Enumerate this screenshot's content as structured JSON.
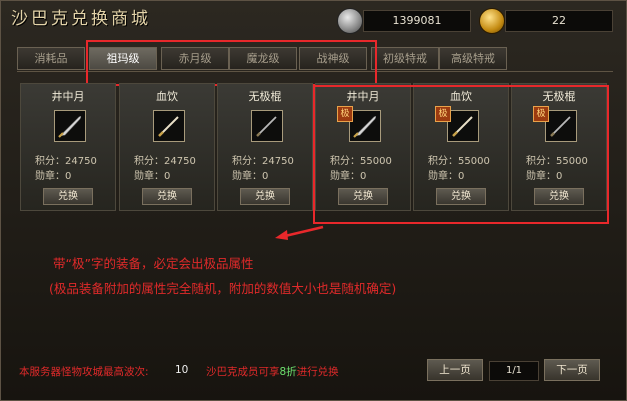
{
  "window": {
    "title": "沙巴克兑换商城"
  },
  "currency": {
    "silver": "1399081",
    "gold": "22"
  },
  "tabs": [
    {
      "label": "消耗品"
    },
    {
      "label": "祖玛级"
    },
    {
      "label": "赤月级"
    },
    {
      "label": "魔龙级"
    },
    {
      "label": "战神级"
    },
    {
      "label": "初级特戒"
    },
    {
      "label": "高级特戒"
    }
  ],
  "items": [
    {
      "name": "井中月",
      "points": "积分：24750",
      "medals": "勋章：0",
      "button": "兑换",
      "badge": ""
    },
    {
      "name": "血饮",
      "points": "积分：24750",
      "medals": "勋章：0",
      "button": "兑换",
      "badge": ""
    },
    {
      "name": "无极棍",
      "points": "积分：24750",
      "medals": "勋章：0",
      "button": "兑换",
      "badge": ""
    },
    {
      "name": "井中月",
      "points": "积分：55000",
      "medals": "勋章：0",
      "button": "兑换",
      "badge": "极"
    },
    {
      "name": "血饮",
      "points": "积分：55000",
      "medals": "勋章：0",
      "button": "兑换",
      "badge": "极"
    },
    {
      "name": "无极棍",
      "points": "积分：55000",
      "medals": "勋章：0",
      "button": "兑换",
      "badge": "极"
    }
  ],
  "info": {
    "line1": "带“极”字的装备，必定会出极品属性",
    "line2": "(极品装备附加的属性完全随机，附加的数值大小也是随机确定)"
  },
  "footer": {
    "waves_label": "本服务器怪物攻城最高波次:",
    "waves_value": "10",
    "discount_prefix": "沙巴克成员可享",
    "discount_value": "8折",
    "discount_suffix": "进行兑换",
    "prev": "上一页",
    "page": "1/1",
    "next": "下一页"
  },
  "colors": {
    "highlight_border": "#e8282b",
    "notice_text": "#e02a2a",
    "discount": "#6ee06e"
  }
}
